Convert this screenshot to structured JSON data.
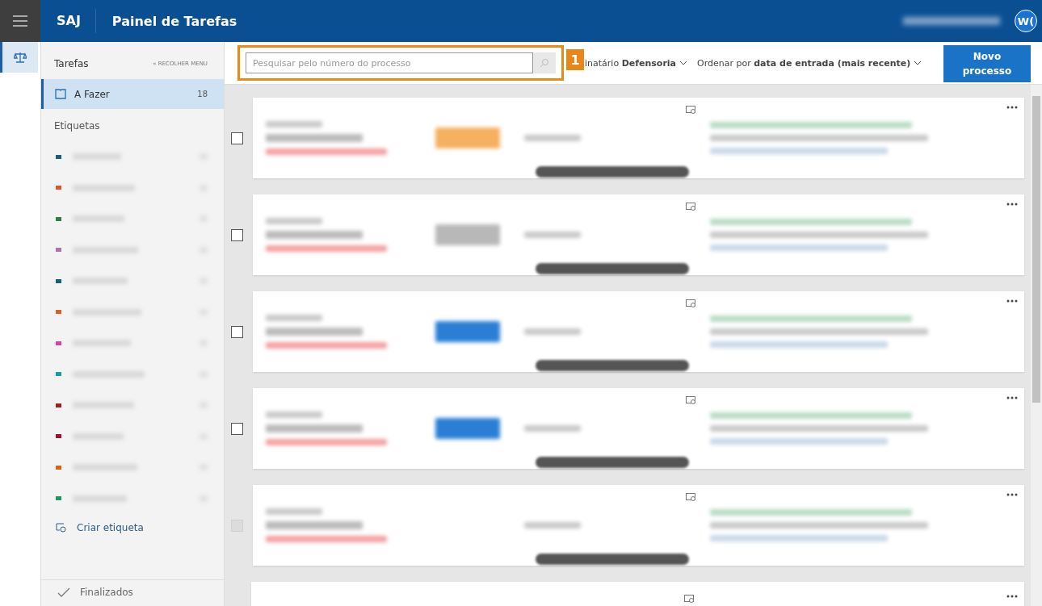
{
  "topbar": {
    "brand": "SAJ",
    "title": "Painel de Tarefas",
    "avatar": "W("
  },
  "sidebar": {
    "header": "Tarefas",
    "collapse": "« RECOLHER MENU",
    "items": [
      {
        "label": "A Fazer",
        "count": "18",
        "selected": true
      }
    ],
    "tags_title": "Etiquetas",
    "tags": [
      {
        "color": "#1b5e7a"
      },
      {
        "color": "#e0552a"
      },
      {
        "color": "#2e7d46"
      },
      {
        "color": "#b070a8"
      },
      {
        "color": "#1b5e7a"
      },
      {
        "color": "#e06020"
      },
      {
        "color": "#e040a0"
      },
      {
        "color": "#1a9aa8"
      },
      {
        "color": "#a02020"
      },
      {
        "color": "#a01030"
      },
      {
        "color": "#e06010"
      },
      {
        "color": "#1a9a60"
      }
    ],
    "create_tag": "Criar etiqueta",
    "finished": "Finalizados"
  },
  "toolbar": {
    "search": {
      "placeholder": "Pesquisar pelo número do processo"
    },
    "callout": "1",
    "filters": [
      "inatário **Defensoria**",
      "Ordenar por **data de entrada (mais recente)**"
    ],
    "new_button": "Novo processo"
  },
  "cards": [
    {
      "kind": "full",
      "checked": false,
      "disabled": false,
      "color": "#f5b060"
    },
    {
      "kind": "full",
      "checked": false,
      "disabled": false,
      "color": "#b8b8b8"
    },
    {
      "kind": "full",
      "checked": false,
      "disabled": false,
      "color": "#2a7fd4"
    },
    {
      "kind": "full",
      "checked": false,
      "disabled": false,
      "color": "#2a7fd4"
    },
    {
      "kind": "full",
      "checked": false,
      "disabled": true
    },
    {
      "kind": "partial"
    }
  ]
}
